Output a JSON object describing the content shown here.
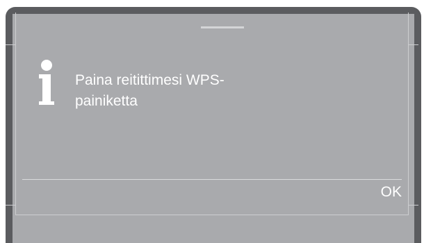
{
  "dialog": {
    "icon": "info-icon",
    "message_line1": "Paina reitittimesi WPS-",
    "message_line2": "painiketta",
    "ok_label": "OK"
  },
  "colors": {
    "bezel": "#5b5c5f",
    "screen": "#a9aaad",
    "text": "#ffffff"
  }
}
